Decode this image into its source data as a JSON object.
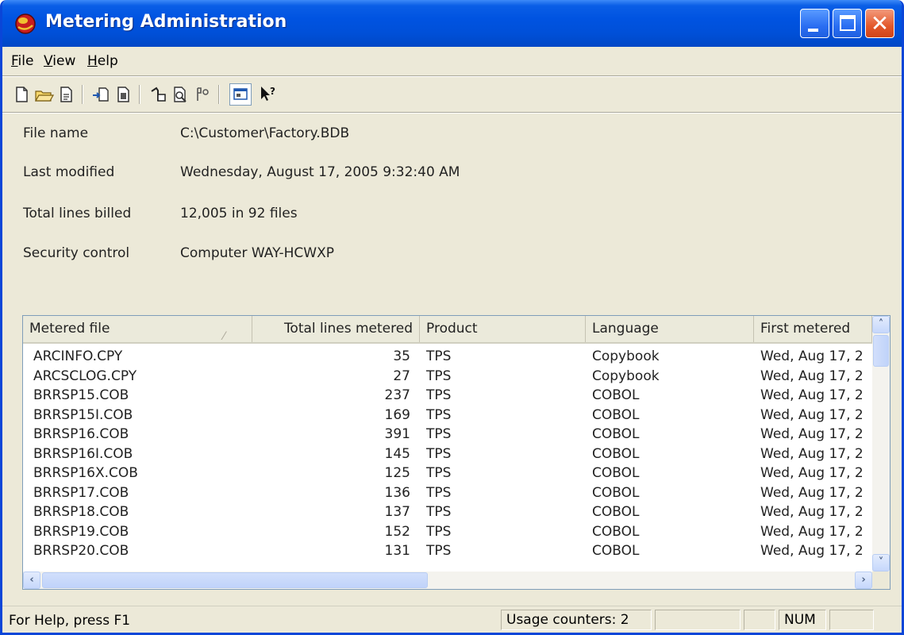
{
  "window": {
    "title": "Metering Administration"
  },
  "menu": [
    {
      "label": "File"
    },
    {
      "label": "View"
    },
    {
      "label": "Help"
    }
  ],
  "toolbar": {
    "buttons": [
      {
        "icon": "new-file-icon"
      },
      {
        "icon": "open-folder-icon"
      },
      {
        "icon": "properties-icon"
      },
      {
        "icon": "import-icon"
      },
      {
        "icon": "report-icon"
      },
      {
        "icon": "link-icon"
      },
      {
        "icon": "find-icon"
      },
      {
        "icon": "security-icon"
      },
      {
        "icon": "view-icon",
        "pressed": true
      },
      {
        "icon": "context-help-icon"
      }
    ]
  },
  "info": {
    "file_name_label": "File name",
    "file_name_value": "C:\\Customer\\Factory.BDB",
    "last_modified_label": "Last modified",
    "last_modified_value": "Wednesday, August 17, 2005 9:32:40 AM",
    "total_lines_label": "Total lines billed",
    "total_lines_value": "12,005 in 92 files",
    "security_label": "Security control",
    "security_value": "Computer WAY-HCWXP"
  },
  "table": {
    "columns": [
      "Metered file",
      "Total lines metered",
      "Product",
      "Language",
      "First metered"
    ],
    "rows": [
      [
        "ARCINFO.CPY",
        "35",
        "TPS",
        "Copybook",
        "Wed, Aug 17, 2"
      ],
      [
        "ARCSCLOG.CPY",
        "27",
        "TPS",
        "Copybook",
        "Wed, Aug 17, 2"
      ],
      [
        "BRRSP15.COB",
        "237",
        "TPS",
        "COBOL",
        "Wed, Aug 17, 2"
      ],
      [
        "BRRSP15I.COB",
        "169",
        "TPS",
        "COBOL",
        "Wed, Aug 17, 2"
      ],
      [
        "BRRSP16.COB",
        "391",
        "TPS",
        "COBOL",
        "Wed, Aug 17, 2"
      ],
      [
        "BRRSP16I.COB",
        "145",
        "TPS",
        "COBOL",
        "Wed, Aug 17, 2"
      ],
      [
        "BRRSP16X.COB",
        "125",
        "TPS",
        "COBOL",
        "Wed, Aug 17, 2"
      ],
      [
        "BRRSP17.COB",
        "136",
        "TPS",
        "COBOL",
        "Wed, Aug 17, 2"
      ],
      [
        "BRRSP18.COB",
        "137",
        "TPS",
        "COBOL",
        "Wed, Aug 17, 2"
      ],
      [
        "BRRSP19.COB",
        "152",
        "TPS",
        "COBOL",
        "Wed, Aug 17, 2"
      ],
      [
        "BRRSP20.COB",
        "131",
        "TPS",
        "COBOL",
        "Wed, Aug 17, 2"
      ]
    ]
  },
  "status": {
    "help_text": "For Help, press F1",
    "usage": "Usage counters: 2",
    "num": "NUM"
  }
}
